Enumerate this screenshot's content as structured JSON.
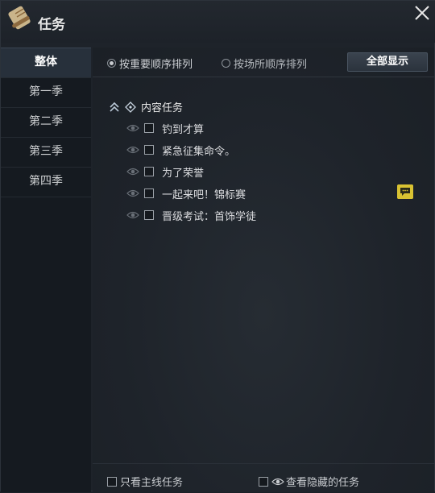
{
  "window": {
    "title": "任务"
  },
  "sidebar": {
    "items": [
      {
        "label": "整体",
        "active": true
      },
      {
        "label": "第一季",
        "active": false
      },
      {
        "label": "第二季",
        "active": false
      },
      {
        "label": "第三季",
        "active": false
      },
      {
        "label": "第四季",
        "active": false
      }
    ]
  },
  "sort": {
    "options": [
      {
        "label": "按重要顺序排列",
        "selected": true
      },
      {
        "label": "按场所顺序排列",
        "selected": false
      }
    ],
    "show_all_label": "全部显示"
  },
  "tree": {
    "category": {
      "label": "内容任务",
      "expanded": true
    },
    "quests": [
      {
        "label": "钓到才算",
        "checked": false,
        "has_chat": false
      },
      {
        "label": "紧急征集命令。",
        "checked": false,
        "has_chat": false
      },
      {
        "label": "为了荣誉",
        "checked": false,
        "has_chat": false
      },
      {
        "label": "一起来吧！锦标赛",
        "checked": false,
        "has_chat": true
      },
      {
        "label": "晋级考试：首饰学徒",
        "checked": false,
        "has_chat": false
      }
    ]
  },
  "footer": {
    "main_only_label": "只看主线任务",
    "show_hidden_label": "查看隐藏的任务"
  },
  "colors": {
    "background": "#1e232a",
    "sidebar_bg": "#151a20",
    "active_tab": "#27303b",
    "chat_badge": "#d9c232"
  }
}
